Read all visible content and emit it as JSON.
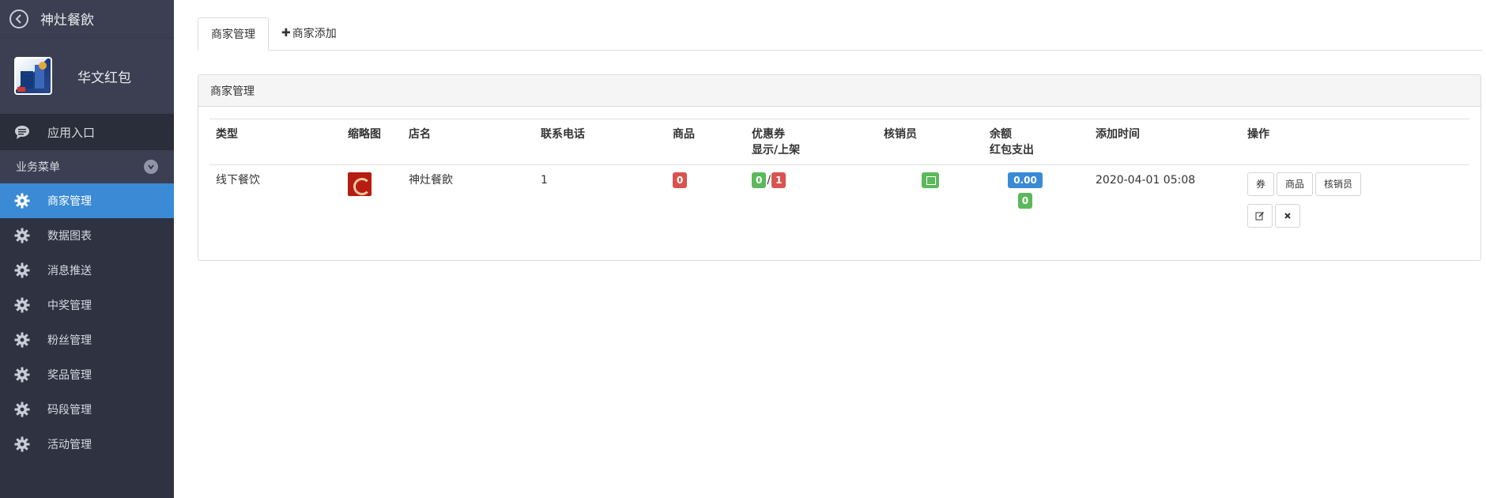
{
  "sidebar": {
    "title": "神灶餐飲",
    "profile_name": "华文红包",
    "entry_label": "应用入口",
    "section_label": "业务菜单",
    "items": [
      {
        "label": "商家管理",
        "active": true
      },
      {
        "label": "数据图表",
        "active": false
      },
      {
        "label": "消息推送",
        "active": false
      },
      {
        "label": "中奖管理",
        "active": false
      },
      {
        "label": "粉丝管理",
        "active": false
      },
      {
        "label": "奖品管理",
        "active": false
      },
      {
        "label": "码段管理",
        "active": false
      },
      {
        "label": "活动管理",
        "active": false
      }
    ]
  },
  "tabs": {
    "manage": "商家管理",
    "add": "商家添加"
  },
  "panel": {
    "title": "商家管理",
    "columns": {
      "type": "类型",
      "thumb": "缩略图",
      "name": "店名",
      "phone": "联系电话",
      "goods": "商品",
      "coupon_line1": "优惠券",
      "coupon_line2": "显示/上架",
      "verifier": "核销员",
      "balance_line1": "余额",
      "balance_line2": "红包支出",
      "added": "添加时间",
      "ops": "操作"
    },
    "rows": [
      {
        "type": "线下餐饮",
        "name": "神灶餐飲",
        "phone": "1",
        "goods": "0",
        "coupon_shown": "0",
        "coupon_listed": "1",
        "balance": "0.00",
        "redpacket": "0",
        "added": "2020-04-01 05:08",
        "btn_coupon": "券",
        "btn_goods": "商品",
        "btn_verifier": "核销员"
      }
    ]
  },
  "colors": {
    "sidebar_bg": "#2f3241",
    "active": "#3a8ad6",
    "danger": "#d9534f",
    "success": "#5cb85c"
  }
}
